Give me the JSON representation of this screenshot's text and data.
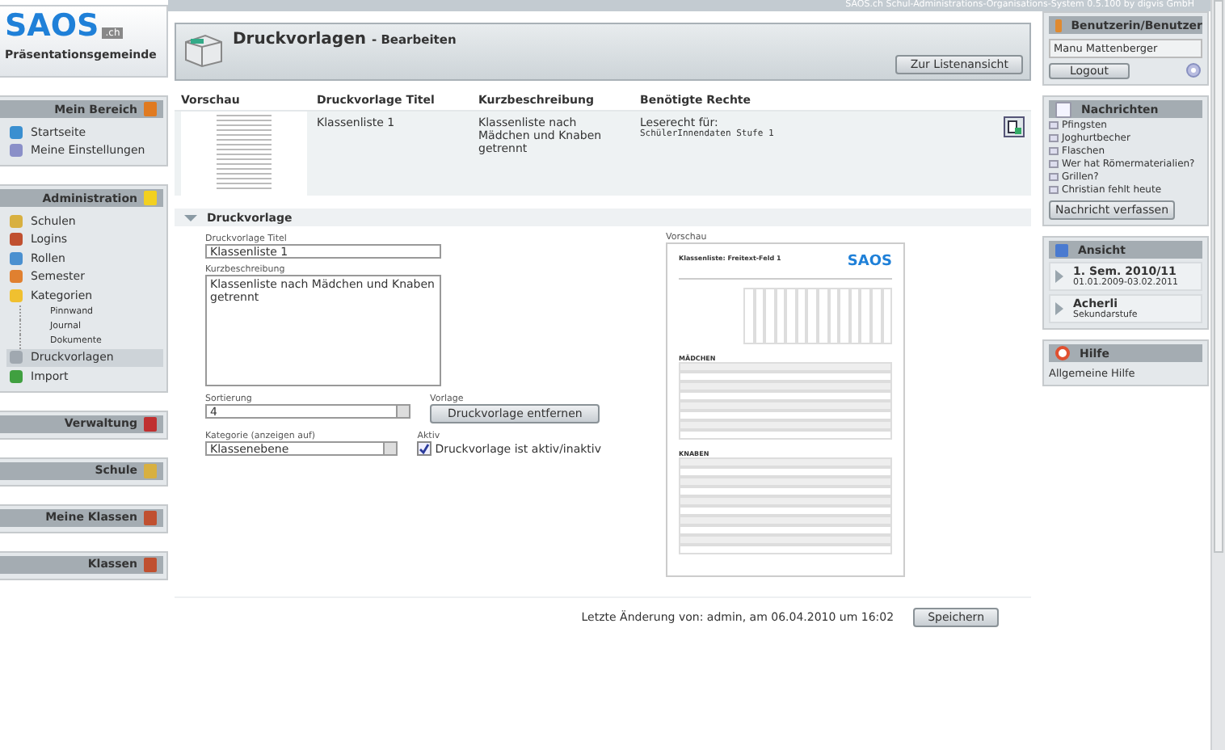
{
  "sidebar": {
    "logo": {
      "text": "SAOS",
      "suffix": ".ch"
    },
    "organization": "Präsentationsgemeinde",
    "panels": [
      {
        "title": "Mein Bereich",
        "items": [
          {
            "label": "Startseite",
            "selected": false
          },
          {
            "label": "Meine Einstellungen",
            "selected": false
          }
        ]
      },
      {
        "title": "Administration",
        "items": [
          {
            "label": "Schulen",
            "selected": false
          },
          {
            "label": "Logins",
            "selected": false
          },
          {
            "label": "Rollen",
            "selected": false
          },
          {
            "label": "Semester",
            "selected": false
          },
          {
            "label": "Kategorien",
            "selected": false,
            "children": [
              {
                "label": "Pinnwand",
                "selected": false
              },
              {
                "label": "Journal",
                "selected": false
              },
              {
                "label": "Dokumente",
                "selected": false
              }
            ]
          },
          {
            "label": "Druckvorlagen",
            "selected": true
          },
          {
            "label": "Import",
            "selected": false
          }
        ]
      },
      {
        "title": "Verwaltung"
      },
      {
        "title": "Schule"
      },
      {
        "title": "Meine Klassen"
      },
      {
        "title": "Klassen"
      }
    ]
  },
  "status_text": "SAOS.ch Schul-Administrations-Organisations-System 0.5.100 by digvis GmbH",
  "header": {
    "title": "Druckvorlagen",
    "subtitle": "- Bearbeiten",
    "button": "Zur Listenansicht"
  },
  "table": {
    "columns": [
      "Vorschau",
      "Druckvorlage Titel",
      "Kurzbeschreibung",
      "Benötigte Rechte"
    ],
    "rows": [
      {
        "title": "Klassenliste 1",
        "description": "Klassenliste nach Mädchen und Knaben getrennt",
        "rights_label": "Leserecht für:",
        "rights_value": "SchülerInnendaten Stufe 1"
      }
    ]
  },
  "section": {
    "title": "Druckvorlage",
    "expanded": true,
    "title_field": {
      "label": "Druckvorlage Titel",
      "value": "Klassenliste 1"
    },
    "description_field": {
      "label": "Kurzbeschreibung",
      "value": "Klassenliste nach Mädchen und Knaben getrennt"
    },
    "sort_field": {
      "label": "Sortierung",
      "value": "4"
    },
    "template": {
      "label": "Vorlage",
      "button": "Druckvorlage entfernen"
    },
    "category_field": {
      "label": "Kategorie (anzeigen auf)",
      "value": "Klassenebene"
    },
    "active": {
      "label": "Aktiv",
      "text": "Druckvorlage ist aktiv/inaktiv",
      "checked": true
    },
    "preview": {
      "label": "Vorschau",
      "doc_title": "Klassenliste: Freitext-Feld 1",
      "doc_logo": "SAOS",
      "groups": [
        "MÄDCHEN",
        "KNABEN"
      ]
    }
  },
  "footer": {
    "text": "Letzte Änderung von: admin, am 06.04.2010 um 16:02",
    "button": "Speichern"
  },
  "right": {
    "user": {
      "title": "Benutzerin/Benutzer",
      "name": "Manu Mattenberger",
      "button": "Logout"
    },
    "messages": {
      "title": "Nachrichten",
      "items": [
        "Pfingsten",
        "Joghurtbecher",
        "Flaschen",
        "Wer hat Römermaterialien?",
        "Grillen?",
        "Christian fehlt heute"
      ],
      "button": "Nachricht verfassen"
    },
    "view": {
      "title": "Ansicht",
      "items": [
        {
          "title": "1. Sem. 2010/11",
          "subtitle": "01.01.2009-03.02.2011"
        },
        {
          "title": "Acherli",
          "subtitle": "Sekundarstufe"
        }
      ]
    },
    "help": {
      "title": "Hilfe",
      "link": "Allgemeine Hilfe"
    }
  }
}
